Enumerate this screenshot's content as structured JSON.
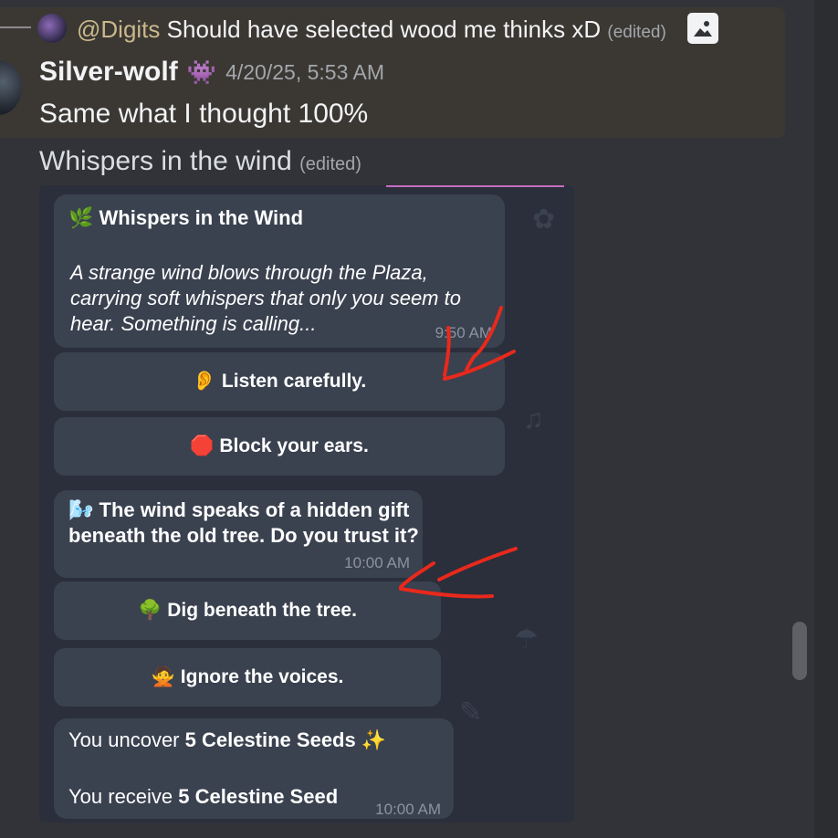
{
  "reply": {
    "mention": "@Digits",
    "text": "Should have selected wood me thinks xD",
    "edited": "(edited)"
  },
  "message": {
    "author": "Silver-wolf",
    "author_emoji": "👾",
    "timestamp": "4/20/25, 5:53 AM",
    "line1": "Same what I thought 100%",
    "line2": "Whispers in the wind",
    "line2_edited": "(edited)"
  },
  "embed": {
    "bubble1": {
      "emoji": "🌿",
      "title": "Whispers in the Wind",
      "l1": "A strange wind blows through the Plaza,",
      "l2": "carrying soft whispers that only you seem to",
      "l3": "hear. Something is calling...",
      "time": "9:50 AM"
    },
    "btn1": {
      "emoji": "👂",
      "label": "Listen carefully."
    },
    "btn2": {
      "emoji": "🛑",
      "label": "Block your ears."
    },
    "bubble2": {
      "emoji": "🌬️",
      "l1": "The wind speaks of a hidden gift",
      "l2": "beneath the old tree. Do you trust it?",
      "time": "10:00 AM"
    },
    "btn3": {
      "emoji": "🌳",
      "label": "Dig beneath the tree."
    },
    "btn4": {
      "emoji": "🙅",
      "label": "Ignore the voices."
    },
    "bubble3": {
      "a_prefix": "You uncover ",
      "a_bold": "5 Celestine Seeds",
      "a_emoji": "✨",
      "b_prefix": "You receive ",
      "b_bold": "5 Celestine Seed",
      "time": "10:00 AM"
    }
  },
  "colors": {
    "background": "#323339",
    "highlight": "#3b3834",
    "bubble": "#3a414f",
    "embed_bg": "#2a2f3b",
    "annotation_arrow": "#e8291c"
  },
  "icons": [
    "image-icon",
    "reply-line-icon",
    "annotation-arrow"
  ]
}
